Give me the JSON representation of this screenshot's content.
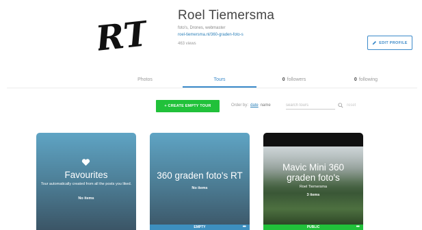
{
  "profile": {
    "logo_text": "RT",
    "name": "Roel Tiemersma",
    "subtitle": "foto's, Drones, webmaster",
    "link": "roel-tiemersma.nl/360-graden-foto-s",
    "views": "463 views",
    "edit_label": "EDIT PROFILE"
  },
  "tabs": {
    "photos": "Photos",
    "tours": "Tours",
    "followers_count": "0",
    "followers_label": "followers",
    "following_count": "0",
    "following_label": "following",
    "active": "Tours"
  },
  "toolbar": {
    "create_label": "+ CREATE EMPTY TOUR",
    "order_by_label": "Order by:",
    "order_date": "date",
    "order_name": "name",
    "search_placeholder": "search tours",
    "reset_label": "reset"
  },
  "cards": [
    {
      "title": "Favourites",
      "subtitle": "Tour automatically created from all the posts you liked.",
      "items": "No items",
      "footer": ""
    },
    {
      "title": "360 graden foto's RT",
      "items": "No items",
      "footer": "EMPTY",
      "more": "•••"
    },
    {
      "title": "Mavic Mini 360 graden foto's",
      "author": "Roel Tiemersma",
      "items": "3 items",
      "footer": "PUBLIC",
      "more": "•••"
    }
  ],
  "colors": {
    "accent": "#3a89c9",
    "create_green": "#21c13a",
    "public_green": "#21c13a",
    "empty_blue": "#3d8fbf"
  }
}
